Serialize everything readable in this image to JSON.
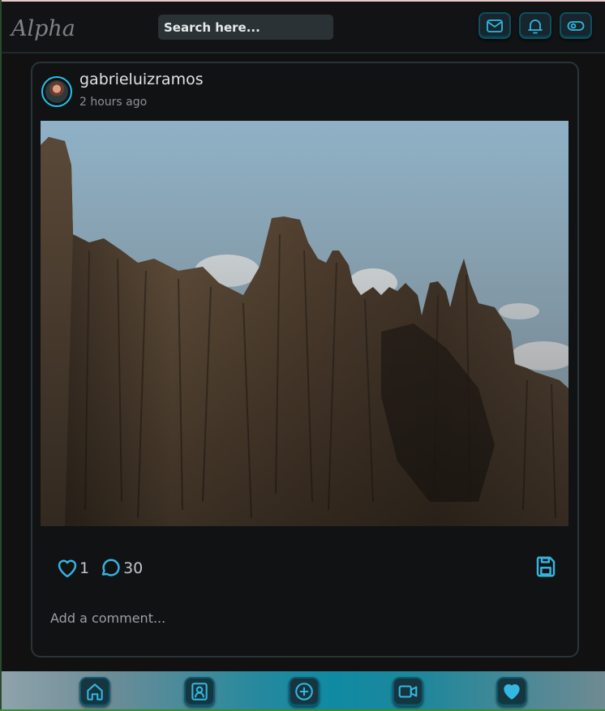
{
  "app": {
    "logo": "Alpha"
  },
  "search": {
    "placeholder": "Search here..."
  },
  "topbar_icons": [
    "mail-icon",
    "bell-icon",
    "toggle-icon"
  ],
  "post": {
    "username": "gabrieluizramos",
    "time": "2 hours ago",
    "likes": "1",
    "comments": "30",
    "comment_placeholder": "Add a comment..."
  },
  "bottom_nav": [
    "home-icon",
    "profile-icon",
    "add-circle-icon",
    "video-icon",
    "heart-icon"
  ],
  "colors": {
    "accent": "#35b3df",
    "background": "#111213",
    "card_border": "#2a3439"
  }
}
